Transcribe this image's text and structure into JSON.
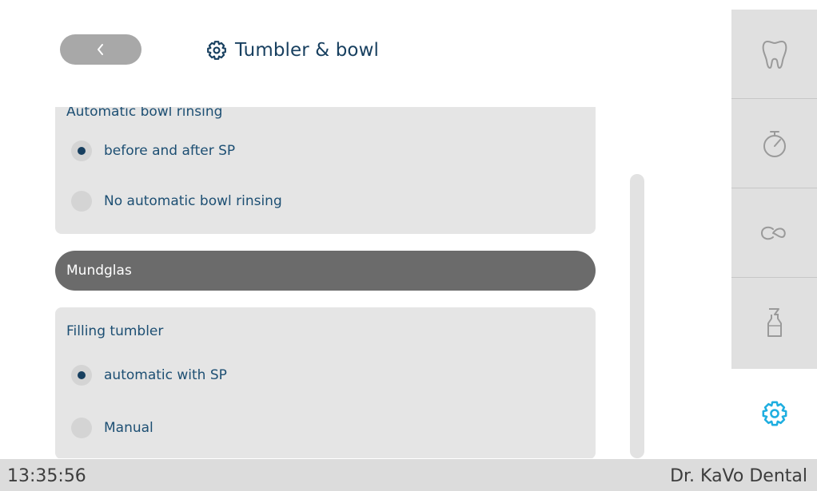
{
  "header": {
    "back_icon": "chevron-left-icon",
    "title_icon": "gear-icon",
    "title": "Tumbler & bowl"
  },
  "bowl_rinsing": {
    "title": "Automatic bowl rinsing",
    "options": [
      {
        "label": "before and after SP",
        "checked": true
      },
      {
        "label": "No automatic bowl rinsing",
        "checked": false
      }
    ]
  },
  "section_header": "Mundglas",
  "tumbler": {
    "title": "Filling tumbler",
    "options": [
      {
        "label": "automatic with SP",
        "checked": true
      },
      {
        "label": "Manual",
        "checked": false
      }
    ]
  },
  "sidebar": {
    "items": [
      {
        "icon": "tooth-icon"
      },
      {
        "icon": "timer-icon"
      },
      {
        "icon": "infinity-icon"
      },
      {
        "icon": "spray-bottle-icon"
      }
    ],
    "active": {
      "icon": "gear-icon"
    }
  },
  "footer": {
    "time": "13:35:56",
    "user": "Dr. KaVo Dental"
  },
  "colors": {
    "text": "#1d4f73",
    "accent": "#1eaee0",
    "section_header_bg": "#6b6b6b",
    "card_bg": "#e5e5e5"
  }
}
